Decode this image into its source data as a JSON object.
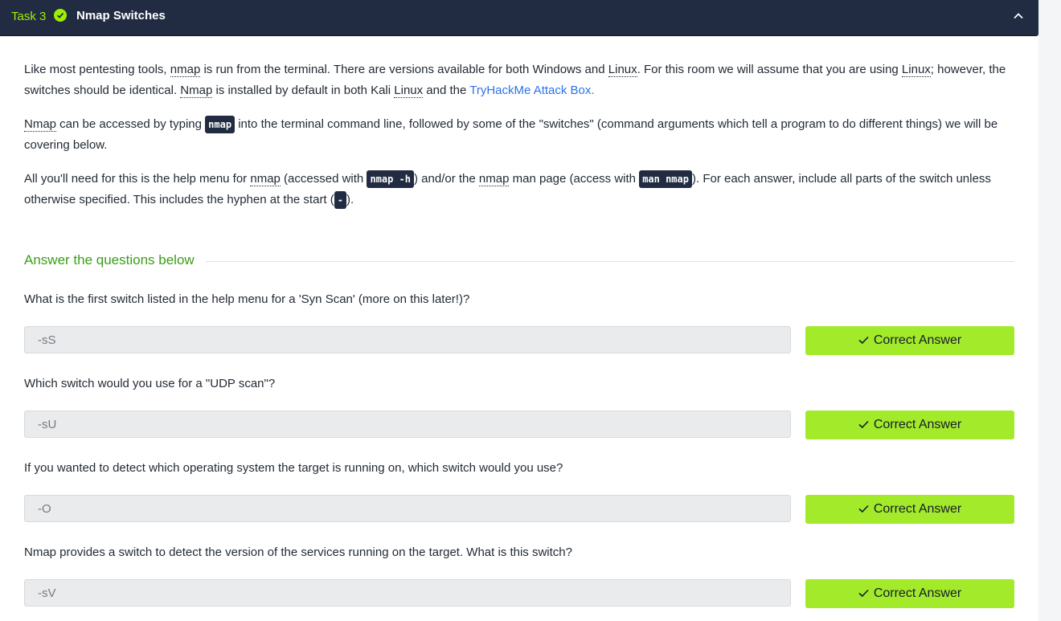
{
  "task": {
    "label": "Task 3",
    "title": "Nmap Switches",
    "status_icon": "check-circle-icon",
    "collapse_icon": "chevron-up-icon"
  },
  "intro": {
    "p1_a": "Like most pentesting tools, ",
    "p1_nmap": "nmap",
    "p1_b": " is run from the terminal. There are versions available for both Windows and ",
    "p1_linux1": "Linux",
    "p1_c": ". For this room we will assume that you are using ",
    "p1_linux2": "Linux",
    "p1_d": "; however, the switches should be identical. ",
    "p1_nmap2": "Nmap",
    "p1_e": " is installed by default in both Kali ",
    "p1_linux3": "Linux",
    "p1_f": " and the ",
    "p1_link": "TryHackMe Attack Box.",
    "p2_nmap": "Nmap",
    "p2_a": " can be accessed by typing ",
    "p2_code": "nmap",
    "p2_b": " into the terminal command line, followed by some of the \"switches\" (command arguments which tell a program to do different things) we will be covering below.",
    "p3_a": "All you'll need for this is the help menu for ",
    "p3_nmap1": "nmap",
    "p3_b": " (accessed with ",
    "p3_code1": "nmap -h",
    "p3_c": ") and/or the ",
    "p3_nmap2": "nmap",
    "p3_d": " man page (access with ",
    "p3_code2": "man nmap",
    "p3_e": "). For each answer, include all parts of the switch unless otherwise specified. This includes the hyphen at the start (",
    "p3_code3": "-",
    "p3_f": ")."
  },
  "answers_heading": "Answer the questions below",
  "questions": [
    {
      "text": "What is the first switch listed in the help menu for a 'Syn Scan' (more on this later!)?",
      "answer": "-sS",
      "button": "Correct Answer"
    },
    {
      "text": "Which switch would you use for a \"UDP scan\"?",
      "answer": "-sU",
      "button": "Correct Answer"
    },
    {
      "text": "If you wanted to detect which operating system the target is running on, which switch would you use?",
      "answer": "-O",
      "button": "Correct Answer"
    },
    {
      "text": "Nmap provides a switch to detect the version of the services running on the target. What is this switch?",
      "answer": "-sV",
      "button": "Correct Answer"
    }
  ],
  "colors": {
    "header_bg": "#212c42",
    "accent_green": "#9fef00",
    "button_green": "#a3ea2a",
    "link_blue": "#2d73e6",
    "heading_green": "#3a9e18"
  }
}
